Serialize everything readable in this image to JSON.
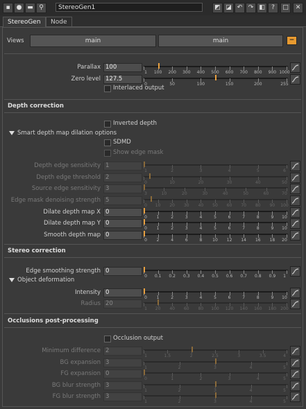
{
  "titlebar": {
    "node_name": "StereoGen1",
    "left_icons": [
      "pin-icon",
      "settings-icon",
      "camera-icon",
      "node-graph-icon"
    ],
    "right_icons": [
      "float-icon",
      "maximize-icon",
      "undo-icon",
      "redo-icon",
      "restore-icon",
      "help-icon",
      "minimize-icon",
      "close-icon"
    ],
    "glyphs": {
      "help": "?",
      "close": "✕",
      "minimize": "□",
      "undo": "↶",
      "redo": "↷"
    }
  },
  "tabs": [
    {
      "label": "StereoGen"
    },
    {
      "label": "Node"
    }
  ],
  "views": {
    "label": "Views",
    "left": "main",
    "right": "main",
    "minus": "−"
  },
  "general": {
    "parallax": {
      "label": "Parallax",
      "value": "100",
      "ticks": [
        "1",
        "100",
        "200",
        "300",
        "400",
        "500",
        "600",
        "700",
        "800",
        "900",
        "1000"
      ]
    },
    "zero_level": {
      "label": "Zero level",
      "value": "127.5",
      "ticks": [
        "0",
        "50",
        "100",
        "150",
        "200",
        "255"
      ]
    },
    "interlaced": {
      "label": "Interlaced output"
    }
  },
  "depth": {
    "title": "Depth correction",
    "inverted": {
      "label": "Inverted depth"
    },
    "smart_group": "Smart depth map dilation options",
    "sdmd": {
      "label": "SDMD"
    },
    "show_edge": {
      "label": "Show edge mask"
    },
    "edge_sens": {
      "label": "Depth edge sensitivity",
      "value": "1",
      "ticks": [
        "1",
        "2",
        "3",
        "4",
        "5",
        "6"
      ]
    },
    "edge_thresh": {
      "label": "Depth edge threshold",
      "value": "2",
      "ticks": [
        "0",
        "10",
        "20",
        "30",
        "40",
        "50"
      ]
    },
    "src_sens": {
      "label": "Source edge sensitivity",
      "value": "3",
      "ticks": [
        "3",
        "10",
        "20",
        "30",
        "40",
        "50",
        "60",
        "70"
      ]
    },
    "denoise": {
      "label": "Edge mask denoising strength",
      "value": "5",
      "ticks": [
        "0",
        "10",
        "20",
        "30",
        "40",
        "50",
        "60",
        "70",
        "80",
        "90",
        "100"
      ]
    },
    "dilate_x": {
      "label": "Dilate depth map X",
      "value": "0",
      "ticks": [
        "0",
        "1",
        "2",
        "3",
        "4",
        "5",
        "6",
        "7",
        "8",
        "9",
        "10"
      ]
    },
    "dilate_y": {
      "label": "Dilate depth map Y",
      "value": "0",
      "ticks": [
        "0",
        "1",
        "2",
        "3",
        "4",
        "5",
        "6",
        "7",
        "8",
        "9",
        "10"
      ]
    },
    "smooth": {
      "label": "Smooth depth map",
      "value": "0",
      "ticks": [
        "0",
        "2",
        "4",
        "6",
        "8",
        "10",
        "12",
        "14",
        "16",
        "18",
        "20"
      ]
    }
  },
  "stereo": {
    "title": "Stereo correction",
    "edge_smooth": {
      "label": "Edge smoothing strength",
      "value": "0",
      "ticks": [
        "0",
        "0.1",
        "0.2",
        "0.3",
        "0.4",
        "0.5",
        "0.6",
        "0.7",
        "0.8",
        "0.9",
        "1"
      ]
    },
    "deform_group": "Object deformation",
    "intensity": {
      "label": "Intensity",
      "value": "0",
      "ticks": [
        "0",
        "1",
        "2",
        "3",
        "4",
        "5",
        "6",
        "7",
        "8",
        "9",
        "10"
      ]
    },
    "radius": {
      "label": "Radius",
      "value": "20",
      "ticks": [
        "1",
        "20",
        "40",
        "60",
        "80",
        "100",
        "120",
        "140",
        "160",
        "180",
        "200"
      ]
    }
  },
  "occlusion": {
    "title": "Occlusions post-processing",
    "output": {
      "label": "Occlusion output"
    },
    "min_diff": {
      "label": "Minimum difference",
      "value": "2",
      "ticks": [
        "1",
        "1.5",
        "2",
        "2.5",
        "3",
        "3.5",
        "4"
      ]
    },
    "bg_exp": {
      "label": "BG expansion",
      "value": "3",
      "ticks": [
        "1",
        "2",
        "3",
        "4",
        "5"
      ]
    },
    "fg_exp": {
      "label": "FG expansion",
      "value": "0",
      "ticks": [
        "0",
        "1",
        "2",
        "3",
        "4",
        "5"
      ]
    },
    "bg_blur": {
      "label": "BG blur strength",
      "value": "3",
      "ticks": [
        "1",
        "2",
        "3",
        "4",
        "5"
      ]
    },
    "fg_blur": {
      "label": "FG blur strength",
      "value": "3",
      "ticks": [
        "1",
        "2",
        "3",
        "4",
        "5"
      ]
    }
  },
  "colors": {
    "accent": "#e89a30",
    "background": "#3a3a3a"
  }
}
